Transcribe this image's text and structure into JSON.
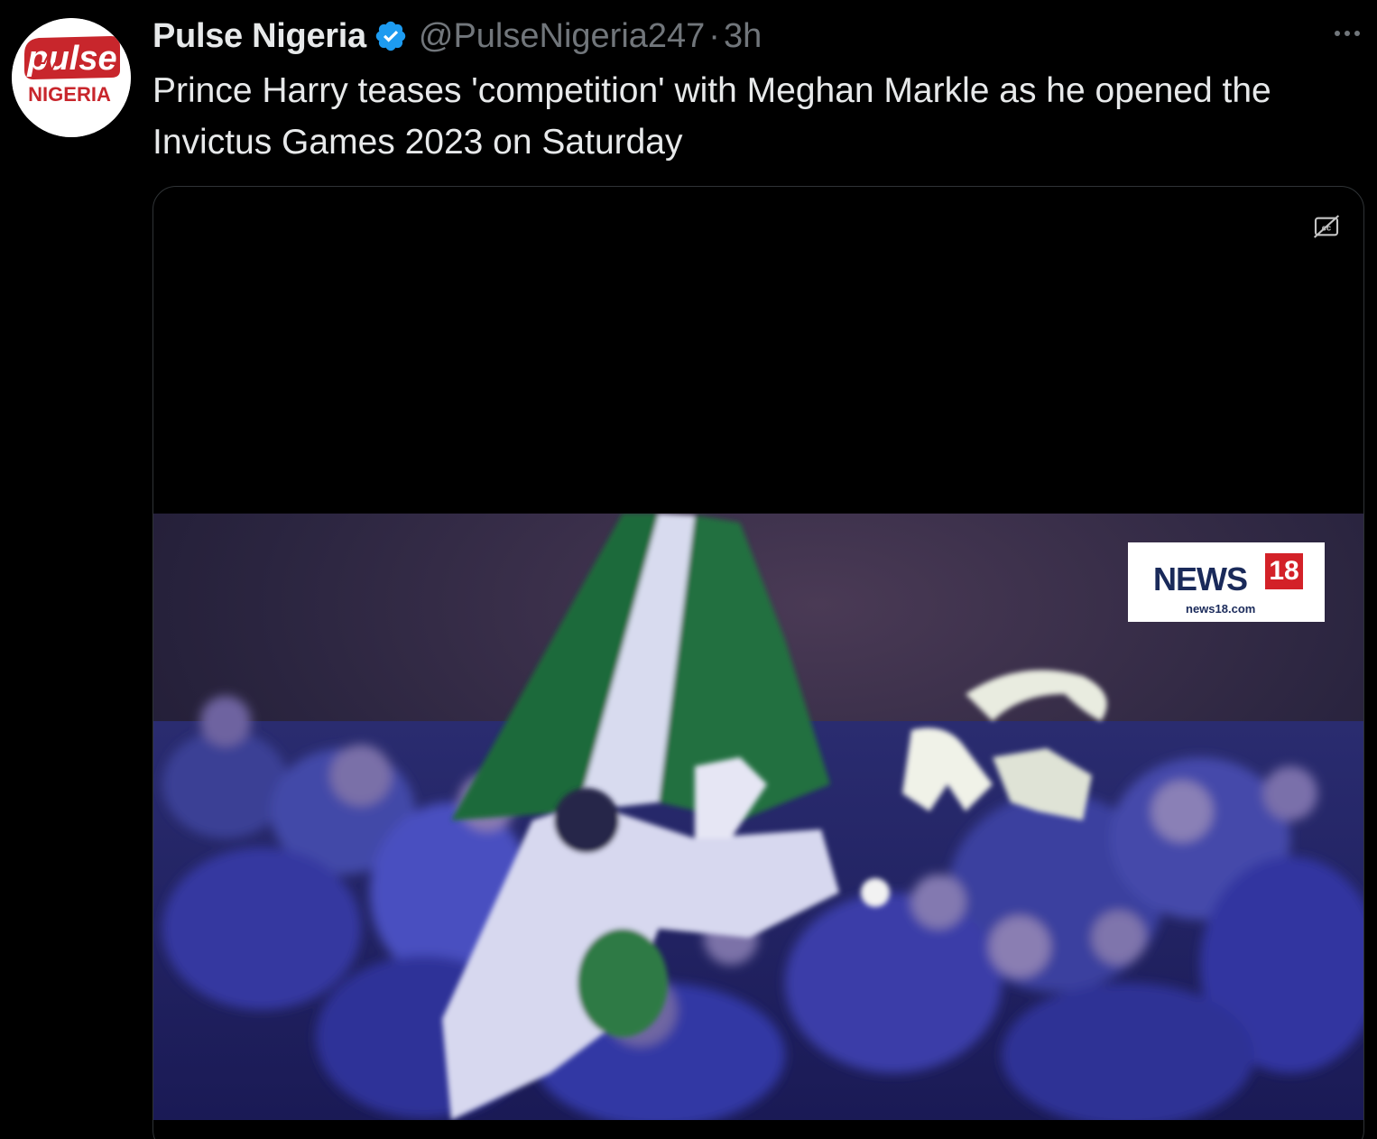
{
  "tweet": {
    "display_name": "Pulse Nigeria",
    "handle": "@PulseNigeria247",
    "separator": "·",
    "time": "3h",
    "text": "Prince Harry teases 'competition' with Meghan Markle as he opened the Invictus Games 2023 on Saturday",
    "avatar": {
      "logo_text": "pulse",
      "sub_text": "NIGERIA"
    },
    "more_icon": "ellipsis-icon",
    "verified_icon": "verified-badge-icon"
  },
  "media": {
    "type": "video",
    "caption_icon": "closed-captions-icon",
    "broadcaster_badge": {
      "word": "NEWS",
      "number": "18",
      "url": "news18.com"
    }
  },
  "colors": {
    "background": "#000000",
    "text_primary": "#e7e9ea",
    "text_secondary": "#71767b",
    "verified": "#1d9bf0",
    "border": "#2f3336",
    "pulse_red": "#c8262c"
  }
}
